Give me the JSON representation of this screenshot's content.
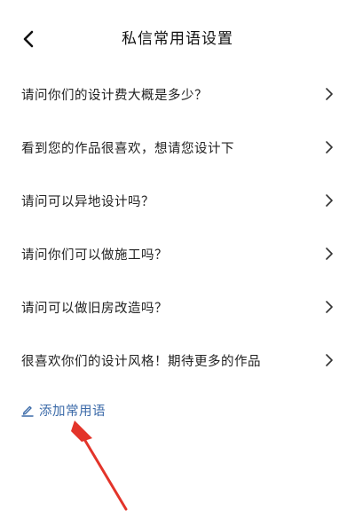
{
  "header": {
    "title": "私信常用语设置"
  },
  "phrases": [
    {
      "label": "请问你们的设计费大概是多少？"
    },
    {
      "label": "看到您的作品很喜欢，想请您设计下"
    },
    {
      "label": "请问可以异地设计吗？"
    },
    {
      "label": "请问你们可以做施工吗？"
    },
    {
      "label": "请问可以做旧房改造吗？"
    },
    {
      "label": "很喜欢你们的设计风格！期待更多的作品"
    }
  ],
  "add": {
    "label": "添加常用语"
  },
  "colors": {
    "accent": "#3b6aa8",
    "annotation_arrow": "#e3342a",
    "text": "#222222"
  },
  "icons": {
    "back": "chevron-left-icon",
    "row": "chevron-right-icon",
    "add": "pencil-icon"
  }
}
